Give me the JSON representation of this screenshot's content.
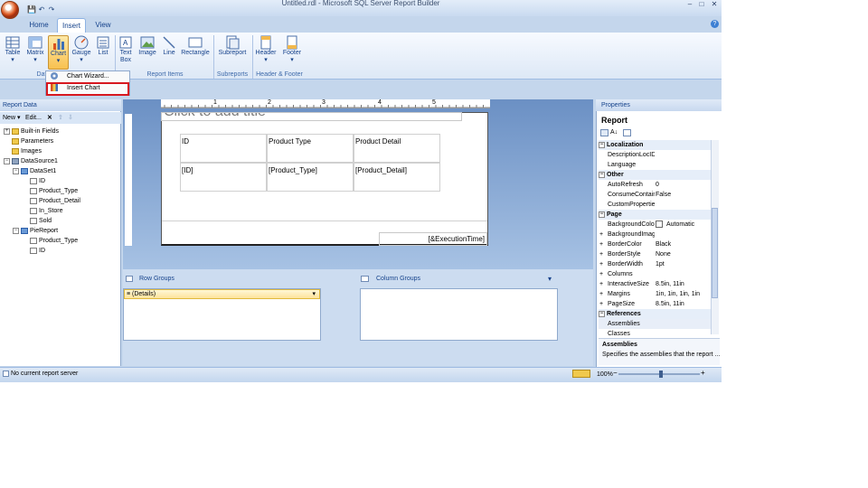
{
  "window": {
    "title": "Untitled.rdl - Microsoft SQL Server Report Builder",
    "controls": [
      "–",
      "□",
      "✕"
    ]
  },
  "quick_access": [
    "save-icon",
    "undo-icon",
    "redo-icon"
  ],
  "tabs": [
    {
      "label": "Home",
      "active": false
    },
    {
      "label": "Insert",
      "active": true
    },
    {
      "label": "View",
      "active": false
    }
  ],
  "ribbon": {
    "data_regions": {
      "label": "Data Regions",
      "label_visible": "Dat",
      "items": [
        {
          "label": "Table",
          "icon": "table-icon"
        },
        {
          "label": "Matrix",
          "icon": "matrix-icon"
        },
        {
          "label": "Chart",
          "icon": "chart-icon",
          "selected": true
        },
        {
          "label": "Gauge",
          "icon": "gauge-icon"
        },
        {
          "label": "List",
          "icon": "list-icon"
        }
      ]
    },
    "report_items": {
      "label": "Report Items",
      "items": [
        {
          "label": "Text",
          "label2": "Box",
          "icon": "textbox-icon"
        },
        {
          "label": "Image",
          "icon": "image-icon"
        },
        {
          "label": "Line",
          "icon": "line-icon"
        },
        {
          "label": "Rectangle",
          "icon": "rectangle-icon"
        }
      ]
    },
    "subreports": {
      "label": "Subreports",
      "items": [
        {
          "label": "Subreport",
          "icon": "subreport-icon"
        }
      ]
    },
    "header_footer": {
      "label": "Header & Footer",
      "items": [
        {
          "label": "Header",
          "icon": "header-icon"
        },
        {
          "label": "Footer",
          "icon": "footer-icon"
        }
      ]
    },
    "dropdown_arrow": "▾"
  },
  "chart_menu": {
    "items": [
      {
        "label": "Chart Wizard...",
        "icon": "chart-wizard-icon"
      },
      {
        "label": "Insert Chart",
        "icon": "insert-chart-icon"
      }
    ]
  },
  "report_data": {
    "title": "Report Data",
    "toolbar": {
      "new": "New ▾",
      "edit": "Edit...",
      "delete": "✕",
      "up": "⇧",
      "down": "⇩"
    },
    "tree": [
      {
        "label": "Built-in Fields",
        "level": 0,
        "exp": "+",
        "icon": "folder"
      },
      {
        "label": "Parameters",
        "level": 0,
        "exp": "",
        "icon": "folder"
      },
      {
        "label": "Images",
        "level": 0,
        "exp": "",
        "icon": "folder"
      },
      {
        "label": "DataSource1",
        "level": 0,
        "exp": "−",
        "icon": "db"
      },
      {
        "label": "DataSet1",
        "level": 1,
        "exp": "−",
        "icon": "ds"
      },
      {
        "label": "ID",
        "level": 2,
        "exp": "",
        "icon": "field"
      },
      {
        "label": "Product_Type",
        "level": 2,
        "exp": "",
        "icon": "field"
      },
      {
        "label": "Product_Detail",
        "level": 2,
        "exp": "",
        "icon": "field"
      },
      {
        "label": "In_Store",
        "level": 2,
        "exp": "",
        "icon": "field"
      },
      {
        "label": "Sold",
        "level": 2,
        "exp": "",
        "icon": "field"
      },
      {
        "label": "PieReport",
        "level": 1,
        "exp": "−",
        "icon": "ds"
      },
      {
        "label": "Product_Type",
        "level": 2,
        "exp": "",
        "icon": "field"
      },
      {
        "label": "ID",
        "level": 2,
        "exp": "",
        "icon": "field"
      }
    ]
  },
  "ruler": {
    "labels": [
      "1",
      "2",
      "3",
      "4",
      "5"
    ]
  },
  "design": {
    "title_placeholder": "Click to add title",
    "table": {
      "headers": [
        "ID",
        "Product Type",
        "Product Detail"
      ],
      "values": [
        "[ID]",
        "[Product_Type]",
        "[Product_Detail]"
      ]
    },
    "footer_text": "[&ExecutionTime]"
  },
  "groups": {
    "row_groups_label": "Row Groups",
    "column_groups_label": "Column Groups",
    "details_label": "≡ (Details)",
    "dropdown_arrow": "▾"
  },
  "properties": {
    "title": "Properties",
    "object": "Report",
    "rows": [
      {
        "type": "cat",
        "label": "Localization"
      },
      {
        "type": "prop",
        "name": "DescriptionLocID",
        "value": ""
      },
      {
        "type": "prop",
        "name": "Language",
        "value": ""
      },
      {
        "type": "cat",
        "label": "Other"
      },
      {
        "type": "prop",
        "name": "AutoRefresh",
        "value": "0"
      },
      {
        "type": "prop",
        "name": "ConsumeContainerWhitespace",
        "value": "False"
      },
      {
        "type": "prop",
        "name": "CustomProperties",
        "value": ""
      },
      {
        "type": "cat",
        "label": "Page"
      },
      {
        "type": "prop",
        "name": "BackgroundColor",
        "value": "Automatic",
        "swatch": true
      },
      {
        "type": "prop",
        "name": "BackgroundImage",
        "value": "",
        "exp": "+"
      },
      {
        "type": "prop",
        "name": "BorderColor",
        "value": "Black",
        "exp": "+"
      },
      {
        "type": "prop",
        "name": "BorderStyle",
        "value": "None",
        "exp": "+"
      },
      {
        "type": "prop",
        "name": "BorderWidth",
        "value": "1pt",
        "exp": "+"
      },
      {
        "type": "prop",
        "name": "Columns",
        "value": "",
        "exp": "+"
      },
      {
        "type": "prop",
        "name": "InteractiveSize",
        "value": "8.5in, 11in",
        "exp": "+"
      },
      {
        "type": "prop",
        "name": "Margins",
        "value": "1in, 1in, 1in, 1in",
        "exp": "+"
      },
      {
        "type": "prop",
        "name": "PageSize",
        "value": "8.5in, 11in",
        "exp": "+"
      },
      {
        "type": "cat",
        "label": "References"
      },
      {
        "type": "prop",
        "name": "Assemblies",
        "value": "",
        "highlight": true
      },
      {
        "type": "prop",
        "name": "Classes",
        "value": ""
      }
    ],
    "desc_title": "Assemblies",
    "desc_text": "Specifies the assemblies that the report ..."
  },
  "status": {
    "text": "No current report server",
    "zoom": "100%",
    "zoom_minus": "−",
    "zoom_plus": "+"
  }
}
